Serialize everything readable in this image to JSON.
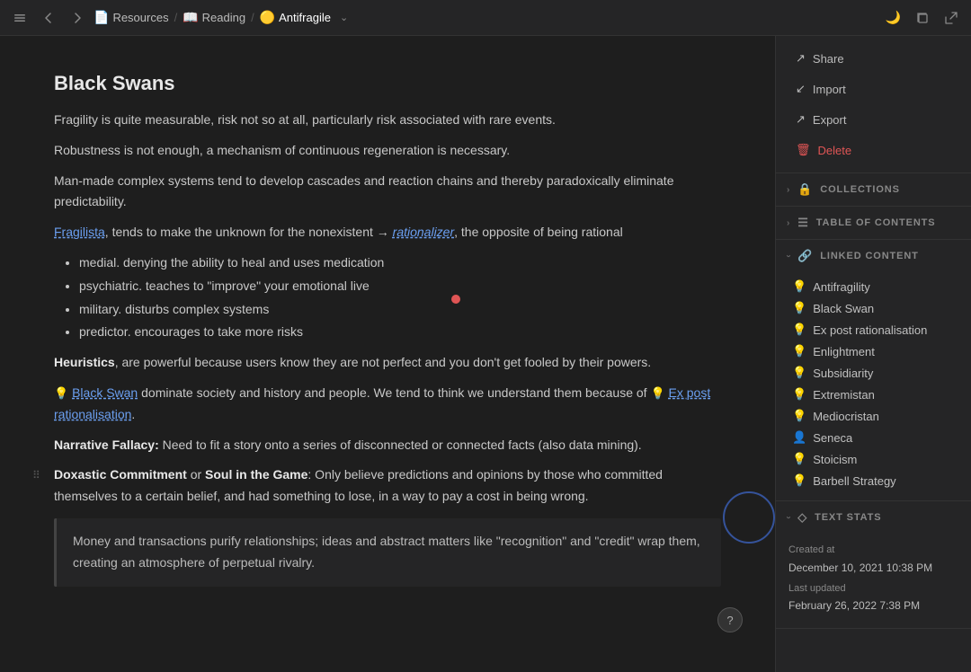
{
  "topbar": {
    "back_btn": "‹",
    "forward_btn": "›",
    "breadcrumb": [
      {
        "id": "resources",
        "label": "Resources",
        "icon": "📄"
      },
      {
        "id": "reading",
        "label": "Reading",
        "icon": "📖"
      },
      {
        "id": "antifragile",
        "label": "Antifragile",
        "icon": "🟡"
      }
    ],
    "dropdown_icon": "⌄",
    "moon_icon": "🌙",
    "copy_icon": "⧉",
    "expand_icon": "⤢"
  },
  "sidebar_right": {
    "actions": [
      {
        "id": "share",
        "label": "Share",
        "icon": "↗"
      },
      {
        "id": "import",
        "label": "Import",
        "icon": "↙"
      },
      {
        "id": "export",
        "label": "Export",
        "icon": "↗"
      },
      {
        "id": "delete",
        "label": "Delete",
        "icon": "🗑",
        "type": "danger"
      }
    ],
    "sections": [
      {
        "id": "collections",
        "label": "COLLECTIONS",
        "icon": "🔒",
        "collapsed": true
      },
      {
        "id": "toc",
        "label": "TABLE OF CONTENTS",
        "icon": "☰",
        "collapsed": true
      },
      {
        "id": "linked_content",
        "label": "LINKED CONTENT",
        "icon": "🔗",
        "collapsed": false,
        "items": [
          {
            "id": "antifragility",
            "label": "Antifragility",
            "icon": "💡",
            "type": "idea"
          },
          {
            "id": "black-swan",
            "label": "Black Swan",
            "icon": "💡",
            "type": "idea"
          },
          {
            "id": "ex-post",
            "label": "Ex post rationalisation",
            "icon": "💡",
            "type": "idea"
          },
          {
            "id": "enlightment",
            "label": "Enlightment",
            "icon": "💡",
            "type": "idea"
          },
          {
            "id": "subsidiarity",
            "label": "Subsidiarity",
            "icon": "💡",
            "type": "idea"
          },
          {
            "id": "extremistan",
            "label": "Extremistan",
            "icon": "💡",
            "type": "idea"
          },
          {
            "id": "mediocristan",
            "label": "Mediocristan",
            "icon": "💡",
            "type": "idea"
          },
          {
            "id": "seneca",
            "label": "Seneca",
            "icon": "👤",
            "type": "person"
          },
          {
            "id": "stoicism",
            "label": "Stoicism",
            "icon": "💡",
            "type": "idea"
          },
          {
            "id": "barbell",
            "label": "Barbell Strategy",
            "icon": "💡",
            "type": "idea"
          }
        ]
      },
      {
        "id": "text_stats",
        "label": "TEXT STATS",
        "icon": "◇",
        "collapsed": false
      }
    ],
    "stats": {
      "created_label": "Created at",
      "created_value": "December 10, 2021 10:38 PM",
      "updated_label": "Last updated",
      "updated_value": "February 26, 2022 7:38 PM"
    }
  },
  "article": {
    "title": "Black Swans",
    "paragraphs": [
      "Fragility is quite measurable, risk not so at all, particularly risk associated with rare events.",
      "Robustness is not enough, a mechanism of continuous regeneration is necessary.",
      "Man-made complex systems tend to develop cascades and reaction chains and thereby paradoxically eliminate predictability."
    ],
    "fragilista_text_before": "",
    "fragilista_link": "Fragilista",
    "fragilista_rest": ", tends to make the unknown for the nonexistent → ",
    "rationalizer_text": "rationalizer",
    "rationalizer_rest": ", the opposite of being rational",
    "list_items": [
      "medial. denying the ability to heal and uses medication",
      "psychiatric. teaches to \"improve\" your emotional live",
      "military. disturbs complex systems",
      "predictor. encourages to take more risks"
    ],
    "heuristics_bold": "Heuristics",
    "heuristics_rest": ", are powerful because users know they are not perfect and you don't get fooled by their powers.",
    "black_swan_inline": "Black Swan",
    "black_swan_rest": " dominate society and history and people. We tend to think we understand them because of ",
    "ex_post_link": "Ex post rationalisation",
    "ex_post_end": ".",
    "narrative_bold": "Narrative Fallacy:",
    "narrative_rest": " Need to fit a story onto a series of disconnected or connected facts (also data mining).",
    "doxastic_bold": "Doxastic Commitment",
    "doxastic_or": " or ",
    "soul_bold": "Soul in the Game",
    "doxastic_rest": ": Only believe predictions and opinions by those who committed themselves to a certain belief, and had something to lose, in a way to pay a cost in being wrong.",
    "blockquote": "Money and transactions purify relationships; ideas and abstract matters like \"recognition\" and \"credit\" wrap them, creating an atmosphere of perpetual rivalry."
  }
}
